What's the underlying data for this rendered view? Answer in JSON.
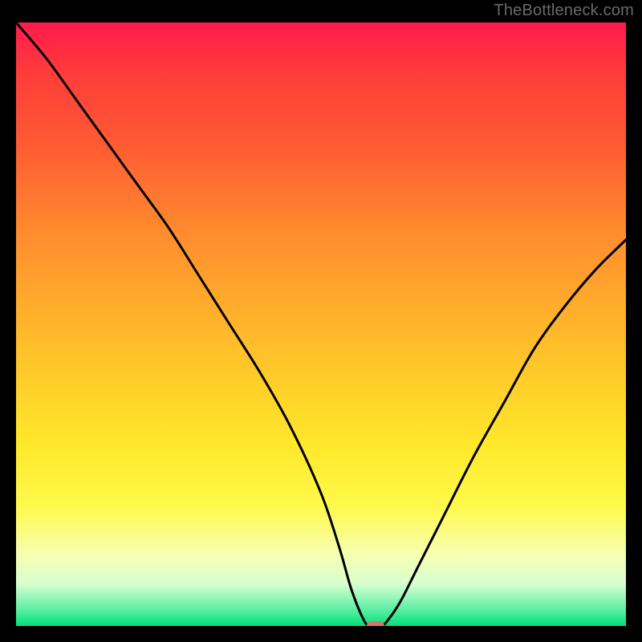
{
  "watermark": "TheBottleneck.com",
  "colors": {
    "gradient_top": "#ff1a4d",
    "gradient_bottom": "#00e27a",
    "curve": "#000000",
    "marker": "#d9746b",
    "frame_bg": "#000000"
  },
  "chart_data": {
    "type": "line",
    "title": "",
    "xlabel": "",
    "ylabel": "",
    "xlim": [
      0,
      100
    ],
    "ylim": [
      0,
      100
    ],
    "grid": false,
    "legend": false,
    "series": [
      {
        "name": "bottleneck-curve",
        "x": [
          0,
          5,
          10,
          15,
          20,
          25,
          30,
          35,
          40,
          45,
          50,
          53,
          55,
          57,
          58,
          59,
          60,
          61,
          63,
          66,
          70,
          75,
          80,
          85,
          90,
          95,
          100
        ],
        "y": [
          100,
          94,
          87,
          80,
          73,
          66,
          58,
          50,
          42,
          33,
          22,
          13,
          6,
          1,
          0,
          0,
          0,
          1,
          4,
          10,
          18,
          28,
          37,
          46,
          53,
          59,
          64
        ]
      }
    ],
    "annotations": [
      {
        "name": "optimal-point",
        "x": 59,
        "y": 0
      }
    ],
    "background_heatmap": {
      "direction": "vertical",
      "top_color": "#ff1a4d",
      "bottom_color": "#00e27a",
      "meaning_top": "high-bottleneck",
      "meaning_bottom": "no-bottleneck"
    }
  }
}
